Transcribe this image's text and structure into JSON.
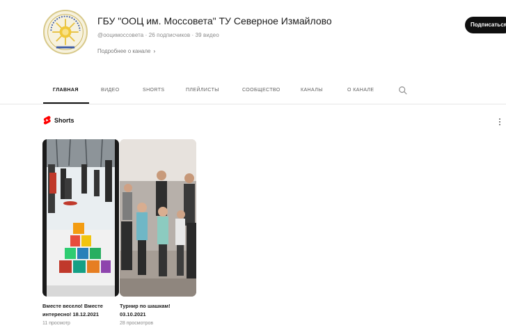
{
  "channel": {
    "name": "ГБУ \"ООЦ им. Моссовета\" ТУ Северное Измайлово",
    "meta": "@ооцимоссовета · 26 подписчиков · 39 видео",
    "more_label": "Подробнее о канале",
    "more_chevron": "›",
    "subscribe_label": "Подписаться",
    "avatar_icon": "channel-logo"
  },
  "tabs": [
    {
      "label": "ГЛАВНАЯ",
      "active": true
    },
    {
      "label": "ВИДЕО",
      "active": false
    },
    {
      "label": "SHORTS",
      "active": false
    },
    {
      "label": "ПЛЕЙЛИСТЫ",
      "active": false
    },
    {
      "label": "СООБЩЕСТВО",
      "active": false
    },
    {
      "label": "КАНАЛЫ",
      "active": false
    },
    {
      "label": "О КАНАЛЕ",
      "active": false
    }
  ],
  "search_icon": "search-icon",
  "shorts_section": {
    "title": "Shorts",
    "icon": "shorts-icon",
    "more_icon": "more-vert-icon",
    "items": [
      {
        "title": "Вместе весело! Вместе интересно! 18.12.2021",
        "views": "11 просмотр"
      },
      {
        "title": "Турнир по шашкам! 03.10.2021",
        "views": "28 просмотров"
      }
    ]
  },
  "colors": {
    "accent": "#0f0f0f",
    "shorts_red": "#ff0000",
    "secondary_text": "#606060"
  }
}
